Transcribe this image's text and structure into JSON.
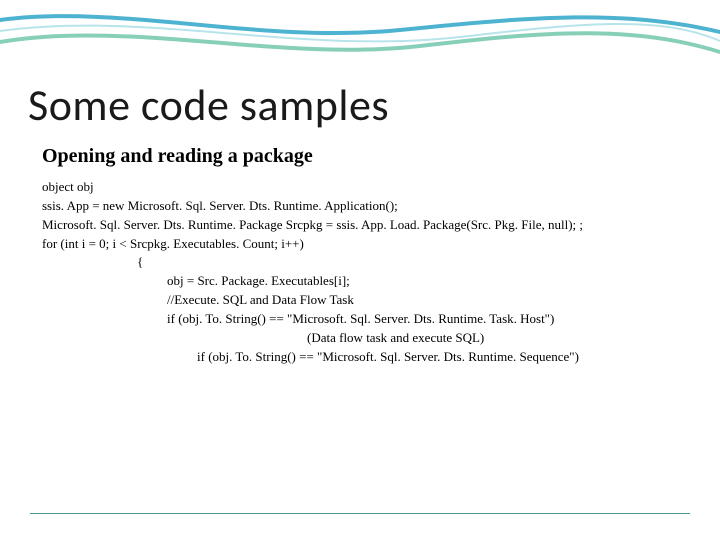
{
  "slide": {
    "title": "Some code samples",
    "subtitle": "Opening and reading a package",
    "code": {
      "l1": "object obj",
      "l2": "ssis. App = new Microsoft. Sql. Server. Dts. Runtime. Application();",
      "l3": "Microsoft. Sql. Server. Dts. Runtime. Package Srcpkg = ssis. App. Load. Package(Src. Pkg. File, null); ;",
      "l4": "for (int i = 0; i < Srcpkg. Executables. Count; i++)",
      "l5": "{",
      "l6": "obj = Src. Package. Executables[i];",
      "l7": "//Execute. SQL and Data Flow Task",
      "l8": "if (obj. To. String() == \"Microsoft. Sql. Server. Dts. Runtime. Task. Host\")",
      "l9": "(Data flow task and execute SQL)",
      "l10": "if (obj. To. String() == \"Microsoft. Sql. Server. Dts. Runtime. Sequence\")"
    }
  },
  "theme": {
    "wave_top_color": "#2fa4c9",
    "wave_bottom_color": "#5fbfa0",
    "rule_color": "#4a9a9a"
  }
}
